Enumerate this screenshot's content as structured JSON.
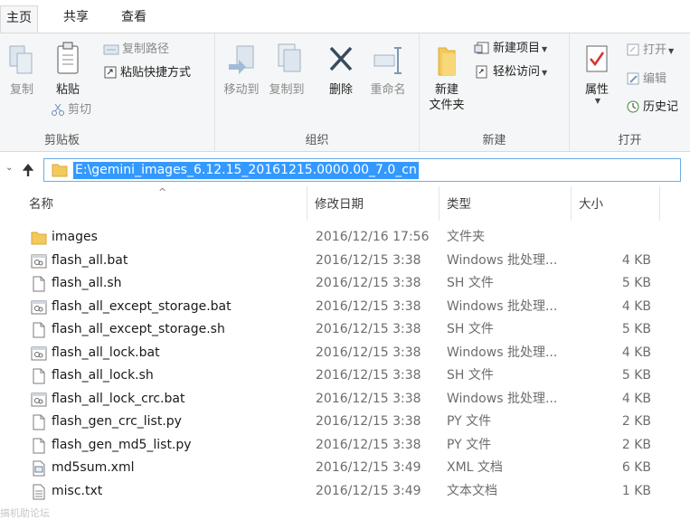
{
  "ribbon_tabs": [
    "主页",
    "共享",
    "查看"
  ],
  "clipboard": {
    "copy": "复制",
    "paste": "粘贴",
    "copy_path": "复制路径",
    "paste_shortcut": "粘贴快捷方式",
    "cut": "剪切",
    "label": "剪贴板"
  },
  "organize": {
    "move_to": "移动到",
    "copy_to": "复制到",
    "delete": "删除",
    "rename": "重命名",
    "label": "组织"
  },
  "new_group": {
    "new_folder": "新建\n文件夹",
    "new_item": "新建项目",
    "easy_access": "轻松访问",
    "label": "新建"
  },
  "open_group": {
    "properties": "属性",
    "open": "打开",
    "edit": "编辑",
    "history": "历史记",
    "label": "打开"
  },
  "address": {
    "path": "E:\\gemini_images_6.12.15_20161215.0000.00_7.0_cn"
  },
  "columns": {
    "name": "名称",
    "date": "修改日期",
    "type": "类型",
    "size": "大小"
  },
  "files": [
    {
      "icon": "folder",
      "name": "images",
      "date": "2016/12/16 17:56",
      "type": "文件夹",
      "size": ""
    },
    {
      "icon": "bat",
      "name": "flash_all.bat",
      "date": "2016/12/15 3:38",
      "type": "Windows 批处理...",
      "size": "4 KB"
    },
    {
      "icon": "file",
      "name": "flash_all.sh",
      "date": "2016/12/15 3:38",
      "type": "SH 文件",
      "size": "5 KB"
    },
    {
      "icon": "bat",
      "name": "flash_all_except_storage.bat",
      "date": "2016/12/15 3:38",
      "type": "Windows 批处理...",
      "size": "4 KB"
    },
    {
      "icon": "file",
      "name": "flash_all_except_storage.sh",
      "date": "2016/12/15 3:38",
      "type": "SH 文件",
      "size": "5 KB"
    },
    {
      "icon": "bat",
      "name": "flash_all_lock.bat",
      "date": "2016/12/15 3:38",
      "type": "Windows 批处理...",
      "size": "4 KB"
    },
    {
      "icon": "file",
      "name": "flash_all_lock.sh",
      "date": "2016/12/15 3:38",
      "type": "SH 文件",
      "size": "5 KB"
    },
    {
      "icon": "bat",
      "name": "flash_all_lock_crc.bat",
      "date": "2016/12/15 3:38",
      "type": "Windows 批处理...",
      "size": "4 KB"
    },
    {
      "icon": "file",
      "name": "flash_gen_crc_list.py",
      "date": "2016/12/15 3:38",
      "type": "PY 文件",
      "size": "2 KB"
    },
    {
      "icon": "file",
      "name": "flash_gen_md5_list.py",
      "date": "2016/12/15 3:38",
      "type": "PY 文件",
      "size": "2 KB"
    },
    {
      "icon": "xml",
      "name": "md5sum.xml",
      "date": "2016/12/15 3:49",
      "type": "XML 文档",
      "size": "6 KB"
    },
    {
      "icon": "txt",
      "name": "misc.txt",
      "date": "2016/12/15 3:49",
      "type": "文本文档",
      "size": "1 KB"
    }
  ],
  "watermark": "搞机助论坛"
}
